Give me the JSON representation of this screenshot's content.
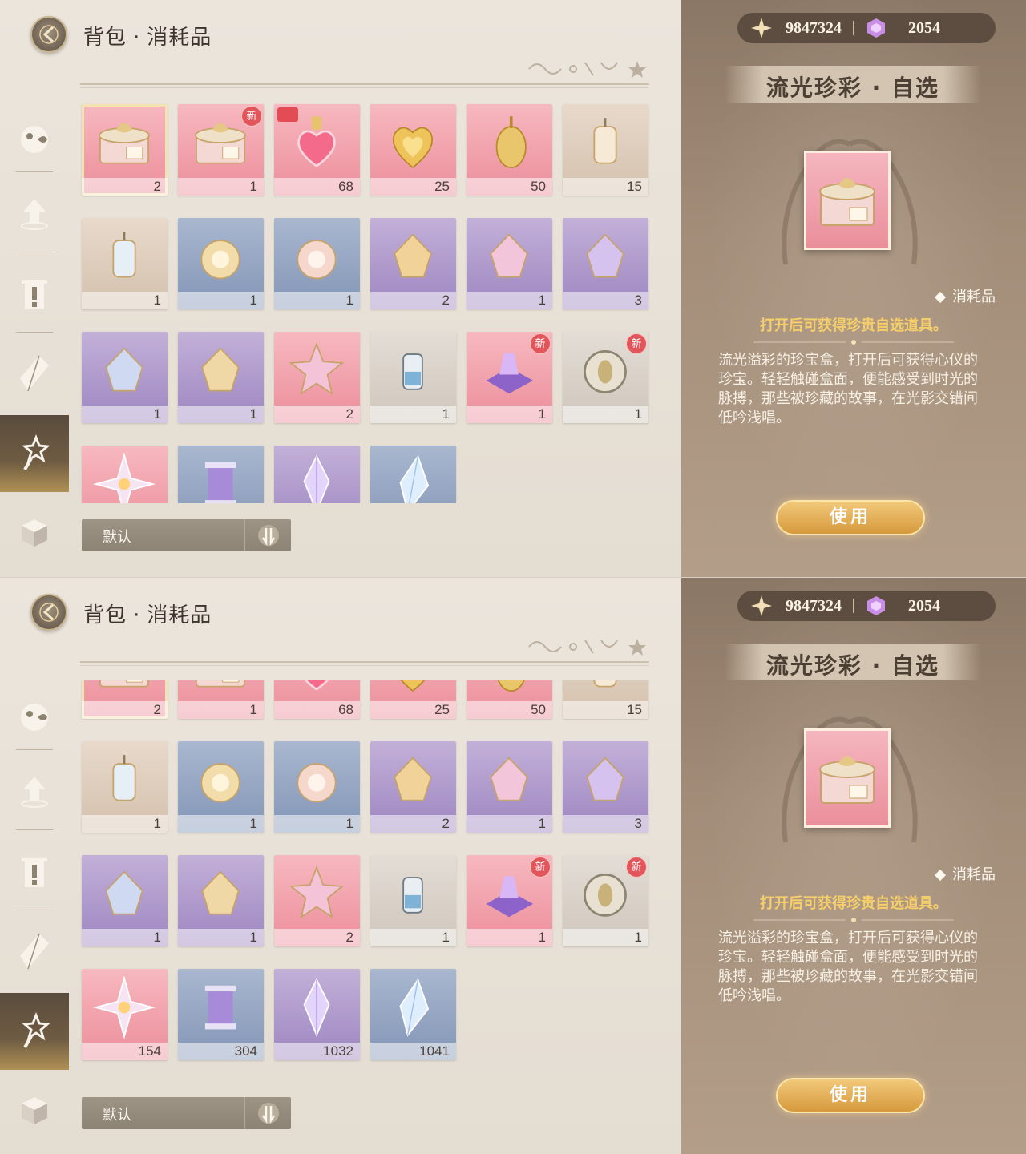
{
  "header": {
    "title_main": "背包",
    "title_sep": "·",
    "title_sub": "消耗品"
  },
  "currency": {
    "stardust": "9847324",
    "gems": "2054"
  },
  "sidebar": {
    "items": [
      {
        "name": "fish",
        "icon": "fish-icon"
      },
      {
        "name": "upgrade",
        "icon": "upgrade-arrow-icon"
      },
      {
        "name": "alert",
        "icon": "exclamation-icon"
      },
      {
        "name": "crystal",
        "icon": "crystal-icon"
      },
      {
        "name": "wand",
        "icon": "star-wand-icon",
        "active": true
      },
      {
        "name": "box",
        "icon": "cube-icon"
      }
    ]
  },
  "items": [
    {
      "count": "2",
      "color": "pink",
      "art": "giftbox",
      "selected": true
    },
    {
      "count": "1",
      "color": "pink",
      "art": "giftbox",
      "badge": "新"
    },
    {
      "count": "68",
      "color": "pink",
      "art": "heart-bottle",
      "tag": true
    },
    {
      "count": "25",
      "color": "pink",
      "art": "golden-heart"
    },
    {
      "count": "50",
      "color": "pink",
      "art": "gold-pendant"
    },
    {
      "count": "15",
      "color": "beige",
      "art": "lantern"
    },
    {
      "count": "1",
      "color": "beige",
      "art": "lantern-blue"
    },
    {
      "count": "1",
      "color": "blue",
      "art": "round-charm"
    },
    {
      "count": "1",
      "color": "blue",
      "art": "round-charm-pink"
    },
    {
      "count": "2",
      "color": "purple",
      "art": "gem-charm-gold"
    },
    {
      "count": "1",
      "color": "purple",
      "art": "gem-charm-pink"
    },
    {
      "count": "3",
      "color": "purple",
      "art": "gem-charm-violet"
    },
    {
      "count": "1",
      "color": "purple",
      "art": "gem-charm-blue"
    },
    {
      "count": "1",
      "color": "purple",
      "art": "gem-charm-gold2"
    },
    {
      "count": "2",
      "color": "pink",
      "art": "star-charm"
    },
    {
      "count": "1",
      "color": "grey",
      "art": "jar"
    },
    {
      "count": "1",
      "color": "pink",
      "art": "crystal-cushion",
      "badge": "新"
    },
    {
      "count": "1",
      "color": "grey",
      "art": "coin",
      "badge": "新"
    },
    {
      "count": "154",
      "color": "pink",
      "art": "rainbow-star"
    },
    {
      "count": "304",
      "color": "blue",
      "art": "thread-spool"
    },
    {
      "count": "1032",
      "color": "purple",
      "art": "violet-crystal"
    },
    {
      "count": "1041",
      "color": "blue",
      "art": "blue-crystal"
    }
  ],
  "sort": {
    "label": "默认"
  },
  "detail": {
    "name": "流光珍彩 · 自选",
    "category": "消耗品",
    "subtitle": "打开后可获得珍贵自选道具。",
    "description": "流光溢彩的珍宝盒，打开后可获得心仪的珍宝。轻轻触碰盒面，便能感受到时光的脉搏，那些被珍藏的故事，在光影交错间低吟浅唱。",
    "use_label": "使用"
  },
  "colors": {
    "accent_gold": "#f7cf6a",
    "new_badge": "#e2555b",
    "panel_brown": "#8b7765"
  }
}
